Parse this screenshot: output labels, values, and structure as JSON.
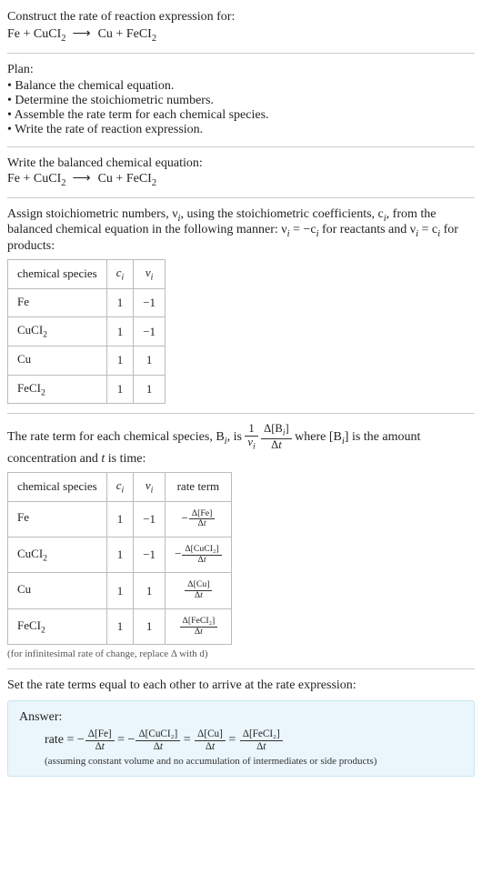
{
  "header": {
    "prompt": "Construct the rate of reaction expression for:",
    "equation_lhs1": "Fe",
    "equation_lhs2": "CuCI",
    "equation_lhs2_sub": "2",
    "arrow": "⟶",
    "equation_rhs1": "Cu",
    "equation_rhs2": "FeCI",
    "equation_rhs2_sub": "2"
  },
  "plan": {
    "title": "Plan:",
    "items": [
      "Balance the chemical equation.",
      "Determine the stoichiometric numbers.",
      "Assemble the rate term for each chemical species.",
      "Write the rate of reaction expression."
    ]
  },
  "balanced": {
    "title": "Write the balanced chemical equation:"
  },
  "stoich": {
    "intro_a": "Assign stoichiometric numbers, ν",
    "intro_b": ", using the stoichiometric coefficients, c",
    "intro_c": ", from the balanced chemical equation in the following manner: ν",
    "intro_d": " = −c",
    "intro_e": " for reactants and ν",
    "intro_f": " = c",
    "intro_g": " for products:",
    "headers": {
      "species": "chemical species",
      "ci": "cᵢ",
      "nui": "νᵢ"
    },
    "rows": [
      {
        "species": "Fe",
        "sub": "",
        "ci": "1",
        "nui": "−1"
      },
      {
        "species": "CuCI",
        "sub": "2",
        "ci": "1",
        "nui": "−1"
      },
      {
        "species": "Cu",
        "sub": "",
        "ci": "1",
        "nui": "1"
      },
      {
        "species": "FeCI",
        "sub": "2",
        "ci": "1",
        "nui": "1"
      }
    ]
  },
  "rateterm": {
    "intro_a": "The rate term for each chemical species, B",
    "intro_b": ", is ",
    "intro_c": " where [B",
    "intro_d": "] is the amount concentration and ",
    "t_var": "t",
    "intro_e": " is time:",
    "headers": {
      "species": "chemical species",
      "ci": "cᵢ",
      "nui": "νᵢ",
      "rate": "rate term"
    },
    "rows": [
      {
        "species": "Fe",
        "sub": "",
        "ci": "1",
        "nui": "−1",
        "sign": "−",
        "num": "Δ[Fe]",
        "den": "Δt"
      },
      {
        "species": "CuCI",
        "sub": "2",
        "ci": "1",
        "nui": "−1",
        "sign": "−",
        "num": "Δ[CuCI₂]",
        "den": "Δt"
      },
      {
        "species": "Cu",
        "sub": "",
        "ci": "1",
        "nui": "1",
        "sign": "",
        "num": "Δ[Cu]",
        "den": "Δt"
      },
      {
        "species": "FeCI",
        "sub": "2",
        "ci": "1",
        "nui": "1",
        "sign": "",
        "num": "Δ[FeCI₂]",
        "den": "Δt"
      }
    ],
    "note": "(for infinitesimal rate of change, replace Δ with d)"
  },
  "final": {
    "title": "Set the rate terms equal to each other to arrive at the rate expression:",
    "answer_label": "Answer:",
    "rate_word": "rate",
    "terms": [
      {
        "sign": "−",
        "num": "Δ[Fe]",
        "den": "Δt"
      },
      {
        "sign": "−",
        "num": "Δ[CuCI₂]",
        "den": "Δt"
      },
      {
        "sign": "",
        "num": "Δ[Cu]",
        "den": "Δt"
      },
      {
        "sign": "",
        "num": "Δ[FeCI₂]",
        "den": "Δt"
      }
    ],
    "assumption": "(assuming constant volume and no accumulation of intermediates or side products)"
  },
  "frac_labels": {
    "one": "1",
    "nu_i": "νᵢ",
    "dBi": "Δ[Bᵢ]",
    "dt": "Δt"
  }
}
